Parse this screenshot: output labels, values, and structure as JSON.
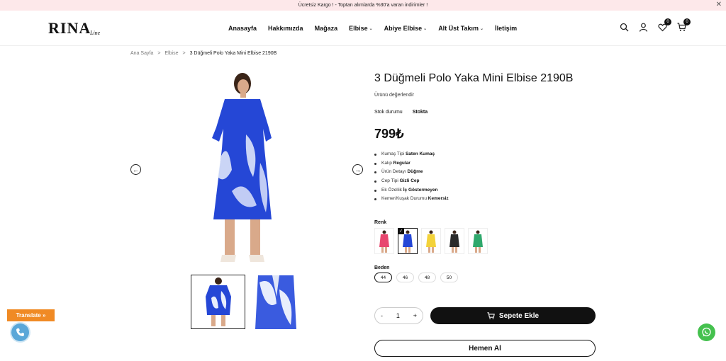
{
  "announcement": "Ücretsiz Kargo ! - Toptan alımlarda %30'a varan indirimler !",
  "close_glyph": "✕",
  "brand": {
    "name": "RINA",
    "sub": "Line"
  },
  "nav": [
    {
      "label": "Anasayfa",
      "dropdown": false
    },
    {
      "label": "Hakkımızda",
      "dropdown": false
    },
    {
      "label": "Mağaza",
      "dropdown": false
    },
    {
      "label": "Elbise",
      "dropdown": true
    },
    {
      "label": "Abiye Elbise",
      "dropdown": true
    },
    {
      "label": "Alt Üst Takım",
      "dropdown": true
    },
    {
      "label": "İletişim",
      "dropdown": false
    }
  ],
  "header_icons": {
    "search": "search-icon",
    "account": "user-icon",
    "wishlist": "heart-icon",
    "cart": "cart-icon",
    "wishlist_count": "0",
    "cart_count": "0"
  },
  "breadcrumb": {
    "home": "Ana Sayfa",
    "category": "Elbise",
    "current": "3 Düğmeli Polo Yaka Mini Elbise 2190B",
    "separator": ">"
  },
  "product": {
    "title": "3 Düğmeli Polo Yaka Mini Elbise 2190B",
    "rating_text": "Ürünü değerlendir",
    "stock_label": "Stok durumu",
    "stock_value": "Stokta",
    "price": "799₺",
    "features": [
      {
        "k": "Kumaş Tipi",
        "v": "Saten Kumaş"
      },
      {
        "k": "Kalıp",
        "v": "Regular"
      },
      {
        "k": "Ürün Detayı",
        "v": "Düğme"
      },
      {
        "k": "Cep Tipi",
        "v": "Gizli Cep"
      },
      {
        "k": "Ek Özellik",
        "v": "İç Göstermeyen"
      },
      {
        "k": "Kemer/Kuşak Durumu",
        "v": "Kemersiz"
      }
    ],
    "color_label": "Renk",
    "colors": [
      "#e8476e",
      "#2547d6",
      "#f3d23a",
      "#2b2b2b",
      "#2fa86c"
    ],
    "selected_color": 1,
    "size_label": "Beden",
    "sizes": [
      "44",
      "46",
      "48",
      "50"
    ],
    "selected_size": 0,
    "qty": {
      "minus": "-",
      "value": "1",
      "plus": "+"
    },
    "add_to_cart": "Sepete Ekle",
    "buy_now": "Hemen Al"
  },
  "translate_label": "Translate »",
  "colors": {
    "dress_blue": "#2547d6",
    "brand_black": "#111111",
    "translate_orange": "#f08a24",
    "whatsapp_green": "#45c14e",
    "phone_blue": "#5aa7d8",
    "announce_bg": "#fde8ea"
  }
}
